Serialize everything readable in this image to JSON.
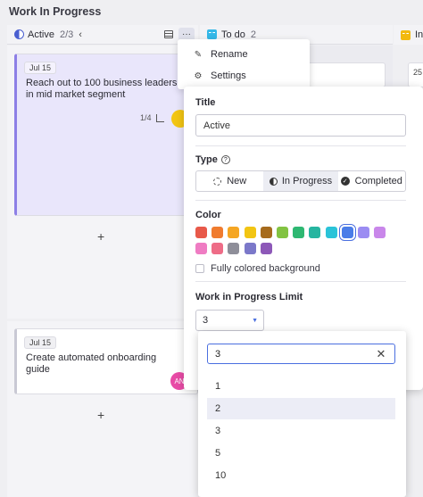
{
  "board": {
    "title": "Work In Progress"
  },
  "columns": {
    "active": {
      "name": "Active",
      "count": "2/3",
      "chevron": "‹",
      "more": "···",
      "icon_color": "#4a5fd0"
    },
    "todo": {
      "name": "To do",
      "count": "2",
      "icon_color": "#35b8e8"
    },
    "third": {
      "name": "In",
      "icon_color": "#f2b90f"
    }
  },
  "cards": [
    {
      "date": "Jul 15",
      "title": "Reach out to 100 business leaders in mid market segment",
      "subtasks": "1/4",
      "avatar_color": "#f2c513"
    },
    {
      "date": "Jul 15",
      "title": "Create automated onboarding guide",
      "avatar": "AN",
      "avatar_color": "#e84ba6"
    }
  ],
  "partial_card_text": "25",
  "add_label": "+",
  "menu": {
    "rename": "Rename",
    "settings": "Settings"
  },
  "panel": {
    "title_label": "Title",
    "title_value": "Active",
    "type_label": "Type",
    "type_help": "?",
    "types": [
      "New",
      "In Progress",
      "Completed"
    ],
    "selected_type": "In Progress",
    "color_label": "Color",
    "colors": [
      "#e8594a",
      "#f07c2f",
      "#f5a623",
      "#f2c513",
      "#a66b1d",
      "#82c342",
      "#2eb872",
      "#26b5a0",
      "#2ac3d8",
      "#4a7de8",
      "#9b8cf2",
      "#c987ea",
      "#ef7cc3",
      "#ee6c87",
      "#8e8e99",
      "#7b78c9",
      "#8d58b8"
    ],
    "selected_color": "#4a7de8",
    "fully_colored_label": "Fully colored background",
    "wip_label": "Work in Progress Limit",
    "wip_value": "3"
  },
  "dropdown": {
    "search_value": "3",
    "clear": "✕",
    "options": [
      "1",
      "2",
      "3",
      "5",
      "10"
    ],
    "highlighted": "2"
  }
}
